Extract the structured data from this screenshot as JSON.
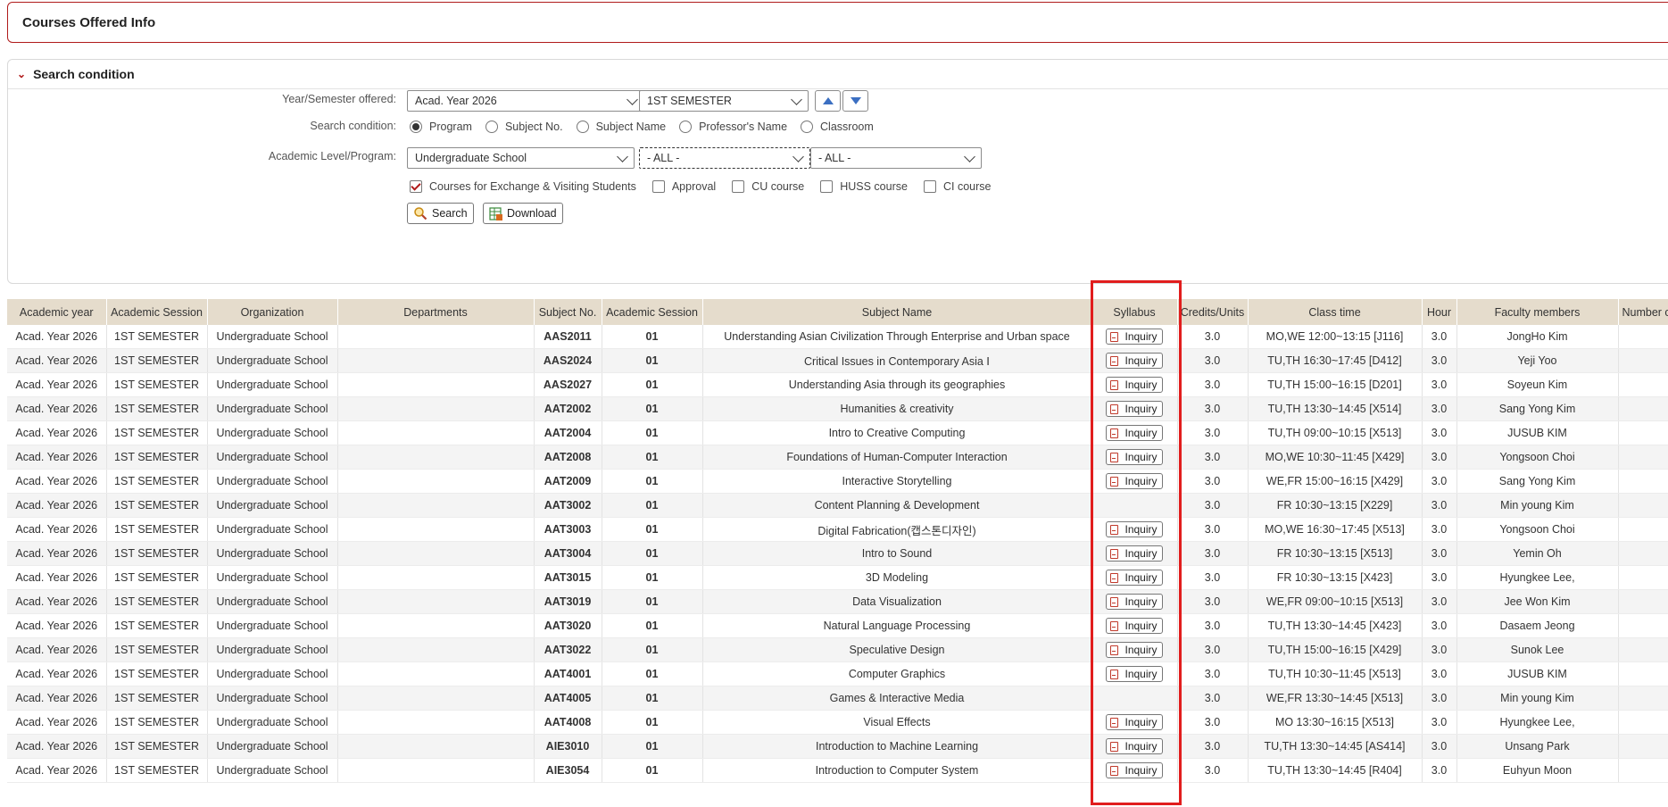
{
  "page": {
    "title": "Courses Offered Info"
  },
  "search": {
    "section_title": "Search condition",
    "year_semester_label": "Year/Semester offered:",
    "year_value": "Acad. Year 2026",
    "semester_value": "1ST SEMESTER",
    "condition_label": "Search condition:",
    "condition_options": [
      "Program",
      "Subject No.",
      "Subject Name",
      "Professor's Name",
      "Classroom"
    ],
    "condition_selected": "Program",
    "level_label": "Academic Level/Program:",
    "level_value": "Undergraduate School",
    "program_value": "- ALL -",
    "dept_value": "- ALL -",
    "checkboxes": [
      {
        "label": "Courses for Exchange & Visiting Students",
        "checked": true
      },
      {
        "label": "Approval",
        "checked": false
      },
      {
        "label": "CU course",
        "checked": false
      },
      {
        "label": "HUSS course",
        "checked": false
      },
      {
        "label": "CI course",
        "checked": false
      }
    ],
    "search_button": "Search",
    "download_button": "Download"
  },
  "table": {
    "headers": [
      "Academic year",
      "Academic Session",
      "Organization",
      "Departments",
      "Subject No.",
      "Academic Session",
      "Subject Name",
      "Syllabus",
      "Credits/Units",
      "Class time",
      "Hour",
      "Faculty members",
      "Number of"
    ],
    "syllabus_label": "Inquiry",
    "rows": [
      {
        "year": "Acad. Year 2026",
        "session": "1ST SEMESTER",
        "org": "Undergraduate School",
        "dept": "",
        "subject_no": "AAS2011",
        "section": "01",
        "name": "Understanding Asian Civilization Through Enterprise and Urban space",
        "syllabus": true,
        "credits": "3.0",
        "time": "MO,WE 12:00~13:15 [J116]",
        "hour": "3.0",
        "faculty": "JongHo Kim"
      },
      {
        "year": "Acad. Year 2026",
        "session": "1ST SEMESTER",
        "org": "Undergraduate School",
        "dept": "",
        "subject_no": "AAS2024",
        "section": "01",
        "name": "Critical Issues in Contemporary Asia Ⅰ",
        "syllabus": true,
        "credits": "3.0",
        "time": "TU,TH 16:30~17:45 [D412]",
        "hour": "3.0",
        "faculty": "Yeji Yoo"
      },
      {
        "year": "Acad. Year 2026",
        "session": "1ST SEMESTER",
        "org": "Undergraduate School",
        "dept": "",
        "subject_no": "AAS2027",
        "section": "01",
        "name": "Understanding Asia through its geographies",
        "syllabus": true,
        "credits": "3.0",
        "time": "TU,TH 15:00~16:15 [D201]",
        "hour": "3.0",
        "faculty": "Soyeun Kim"
      },
      {
        "year": "Acad. Year 2026",
        "session": "1ST SEMESTER",
        "org": "Undergraduate School",
        "dept": "",
        "subject_no": "AAT2002",
        "section": "01",
        "name": "Humanities & creativity",
        "syllabus": true,
        "credits": "3.0",
        "time": "TU,TH 13:30~14:45 [X514]",
        "hour": "3.0",
        "faculty": "Sang Yong Kim"
      },
      {
        "year": "Acad. Year 2026",
        "session": "1ST SEMESTER",
        "org": "Undergraduate School",
        "dept": "",
        "subject_no": "AAT2004",
        "section": "01",
        "name": "Intro to Creative Computing",
        "syllabus": true,
        "credits": "3.0",
        "time": "TU,TH 09:00~10:15 [X513]",
        "hour": "3.0",
        "faculty": "JUSUB KIM"
      },
      {
        "year": "Acad. Year 2026",
        "session": "1ST SEMESTER",
        "org": "Undergraduate School",
        "dept": "",
        "subject_no": "AAT2008",
        "section": "01",
        "name": "Foundations of Human-Computer Interaction",
        "syllabus": true,
        "credits": "3.0",
        "time": "MO,WE 10:30~11:45 [X429]",
        "hour": "3.0",
        "faculty": "Yongsoon Choi"
      },
      {
        "year": "Acad. Year 2026",
        "session": "1ST SEMESTER",
        "org": "Undergraduate School",
        "dept": "",
        "subject_no": "AAT2009",
        "section": "01",
        "name": "Interactive Storytelling",
        "syllabus": true,
        "credits": "3.0",
        "time": "WE,FR 15:00~16:15 [X429]",
        "hour": "3.0",
        "faculty": "Sang Yong Kim"
      },
      {
        "year": "Acad. Year 2026",
        "session": "1ST SEMESTER",
        "org": "Undergraduate School",
        "dept": "",
        "subject_no": "AAT3002",
        "section": "01",
        "name": "Content Planning & Development",
        "syllabus": false,
        "credits": "3.0",
        "time": "FR 10:30~13:15 [X229]",
        "hour": "3.0",
        "faculty": "Min young Kim"
      },
      {
        "year": "Acad. Year 2026",
        "session": "1ST SEMESTER",
        "org": "Undergraduate School",
        "dept": "",
        "subject_no": "AAT3003",
        "section": "01",
        "name": "Digital Fabrication(캡스톤디자인)",
        "syllabus": true,
        "credits": "3.0",
        "time": "MO,WE 16:30~17:45 [X513]",
        "hour": "3.0",
        "faculty": "Yongsoon Choi"
      },
      {
        "year": "Acad. Year 2026",
        "session": "1ST SEMESTER",
        "org": "Undergraduate School",
        "dept": "",
        "subject_no": "AAT3004",
        "section": "01",
        "name": "Intro to Sound",
        "syllabus": true,
        "credits": "3.0",
        "time": "FR 10:30~13:15 [X513]",
        "hour": "3.0",
        "faculty": "Yemin Oh"
      },
      {
        "year": "Acad. Year 2026",
        "session": "1ST SEMESTER",
        "org": "Undergraduate School",
        "dept": "",
        "subject_no": "AAT3015",
        "section": "01",
        "name": "3D Modeling",
        "syllabus": true,
        "credits": "3.0",
        "time": "FR 10:30~13:15 [X423]",
        "hour": "3.0",
        "faculty": "Hyungkee Lee,"
      },
      {
        "year": "Acad. Year 2026",
        "session": "1ST SEMESTER",
        "org": "Undergraduate School",
        "dept": "",
        "subject_no": "AAT3019",
        "section": "01",
        "name": "Data Visualization",
        "syllabus": true,
        "credits": "3.0",
        "time": "WE,FR 09:00~10:15 [X513]",
        "hour": "3.0",
        "faculty": "Jee Won Kim"
      },
      {
        "year": "Acad. Year 2026",
        "session": "1ST SEMESTER",
        "org": "Undergraduate School",
        "dept": "",
        "subject_no": "AAT3020",
        "section": "01",
        "name": "Natural Language Processing",
        "syllabus": true,
        "credits": "3.0",
        "time": "TU,TH 13:30~14:45 [X423]",
        "hour": "3.0",
        "faculty": "Dasaem Jeong"
      },
      {
        "year": "Acad. Year 2026",
        "session": "1ST SEMESTER",
        "org": "Undergraduate School",
        "dept": "",
        "subject_no": "AAT3022",
        "section": "01",
        "name": "Speculative Design",
        "syllabus": true,
        "credits": "3.0",
        "time": "TU,TH 15:00~16:15 [X429]",
        "hour": "3.0",
        "faculty": "Sunok Lee"
      },
      {
        "year": "Acad. Year 2026",
        "session": "1ST SEMESTER",
        "org": "Undergraduate School",
        "dept": "",
        "subject_no": "AAT4001",
        "section": "01",
        "name": "Computer Graphics",
        "syllabus": true,
        "credits": "3.0",
        "time": "TU,TH 10:30~11:45 [X513]",
        "hour": "3.0",
        "faculty": "JUSUB KIM"
      },
      {
        "year": "Acad. Year 2026",
        "session": "1ST SEMESTER",
        "org": "Undergraduate School",
        "dept": "",
        "subject_no": "AAT4005",
        "section": "01",
        "name": "Games & Interactive Media",
        "syllabus": false,
        "credits": "3.0",
        "time": "WE,FR 13:30~14:45 [X513]",
        "hour": "3.0",
        "faculty": "Min young Kim"
      },
      {
        "year": "Acad. Year 2026",
        "session": "1ST SEMESTER",
        "org": "Undergraduate School",
        "dept": "",
        "subject_no": "AAT4008",
        "section": "01",
        "name": "Visual Effects",
        "syllabus": true,
        "credits": "3.0",
        "time": "MO 13:30~16:15 [X513]",
        "hour": "3.0",
        "faculty": "Hyungkee Lee,"
      },
      {
        "year": "Acad. Year 2026",
        "session": "1ST SEMESTER",
        "org": "Undergraduate School",
        "dept": "",
        "subject_no": "AIE3010",
        "section": "01",
        "name": "Introduction to Machine Learning",
        "syllabus": true,
        "credits": "3.0",
        "time": "TU,TH 13:30~14:45 [AS414]",
        "hour": "3.0",
        "faculty": "Unsang Park"
      },
      {
        "year": "Acad. Year 2026",
        "session": "1ST SEMESTER",
        "org": "Undergraduate School",
        "dept": "",
        "subject_no": "AIE3054",
        "section": "01",
        "name": "Introduction to Computer System",
        "syllabus": true,
        "credits": "3.0",
        "time": "TU,TH 13:30~14:45 [R404]",
        "hour": "3.0",
        "faculty": "Euhyun Moon"
      }
    ]
  },
  "colors": {
    "accent": "#b01b1b",
    "header_bg": "#e5dccc",
    "highlight": "#e11d1d"
  }
}
